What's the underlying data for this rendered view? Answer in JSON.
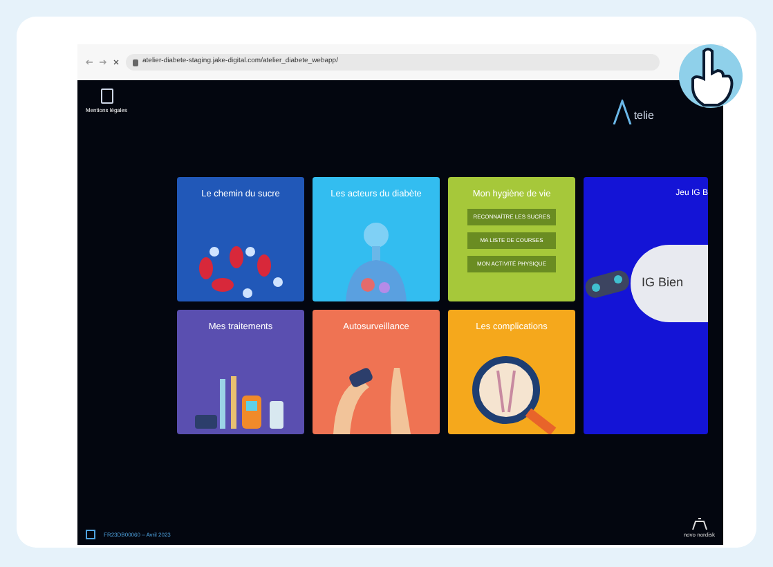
{
  "browser": {
    "url": "atelier-diabete-staging.jake-digital.com/atelier_diabete_webapp/"
  },
  "app": {
    "legal_link": "Mentions légales",
    "logo_text": "telie",
    "footer_code": "FR23DB00060 – Avril 2023",
    "brand": "novo nordisk",
    "tiles": [
      {
        "title": "Le chemin du sucre",
        "color": "#2158b8",
        "kind": "plain"
      },
      {
        "title": "Les acteurs du diabète",
        "color": "#33bdf0",
        "kind": "plain"
      },
      {
        "title": "Mon hygiène de vie",
        "color": "#a6c83a",
        "kind": "menu",
        "buttons": [
          "RECONNAÎTRE LES SUCRES",
          "MA LISTE DE COURSES",
          "MON ACTIVITÉ PHYSIQUE"
        ]
      },
      {
        "title": "Mes traitements",
        "color": "#5a4fb0",
        "kind": "plain"
      },
      {
        "title": "Autosurveillance",
        "color": "#ef7353",
        "kind": "plain"
      },
      {
        "title": "Les complications",
        "color": "#f5a81c",
        "kind": "plain"
      }
    ],
    "feature": {
      "title": "Jeu IG B",
      "image_text": "IG Bien",
      "color": "#1414d6"
    }
  }
}
